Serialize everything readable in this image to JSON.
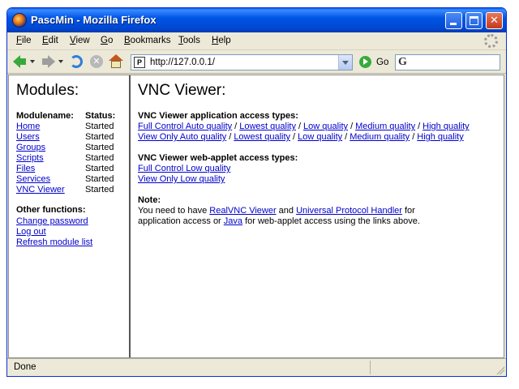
{
  "window": {
    "title": "PascMin - Mozilla Firefox"
  },
  "menu": [
    "File",
    "Edit",
    "View",
    "Go",
    "Bookmarks",
    "Tools",
    "Help"
  ],
  "menu_accel": [
    "F",
    "E",
    "V",
    "G",
    "B",
    "T",
    "H"
  ],
  "navbar": {
    "url": "http://127.0.0.1/",
    "favicon_text": "P",
    "go_label": "Go",
    "search_engine_icon": "google-icon"
  },
  "left": {
    "title": "Modules:",
    "col_name": "Modulename:",
    "col_status": "Status:",
    "modules": [
      {
        "name": "Home",
        "status": "Started"
      },
      {
        "name": "Users",
        "status": "Started"
      },
      {
        "name": "Groups",
        "status": "Started"
      },
      {
        "name": "Scripts",
        "status": "Started"
      },
      {
        "name": "Files",
        "status": "Started"
      },
      {
        "name": "Services",
        "status": "Started"
      },
      {
        "name": "VNC Viewer",
        "status": "Started"
      }
    ],
    "other_title": "Other functions:",
    "functions": [
      "Change password",
      "Log out",
      "Refresh module list"
    ]
  },
  "right": {
    "title": "VNC Viewer:",
    "app_head": "VNC Viewer application access types:",
    "app_full": [
      "Full Control Auto quality",
      "Lowest quality",
      "Low quality",
      "Medium quality",
      "High quality"
    ],
    "app_view": [
      "View Only Auto quality",
      "Lowest quality",
      "Low quality",
      "Medium quality",
      "High quality"
    ],
    "separator": "/",
    "web_head": "VNC Viewer web-applet access types:",
    "web_links": [
      "Full Control Low quality",
      "View Only Low quality"
    ],
    "note_head": "Note:",
    "note": {
      "t1": "You need to have ",
      "link1": "RealVNC Viewer",
      "t2": " and ",
      "link2": "Universal Protocol Handler",
      "t3": " for",
      "t4": "application access or ",
      "link3": "Java",
      "t5": " for web-applet access using the links above."
    }
  },
  "status": {
    "text": "Done"
  }
}
